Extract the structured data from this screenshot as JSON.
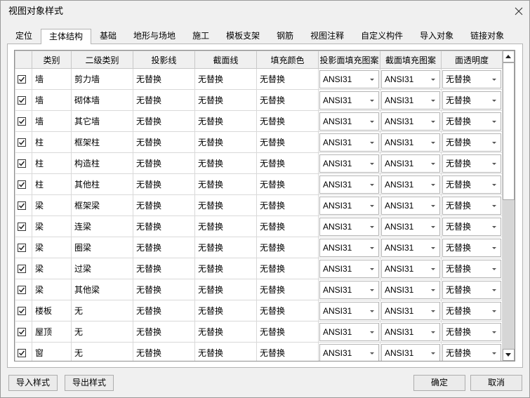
{
  "window": {
    "title": "视图对象样式"
  },
  "tabs": [
    {
      "label": "定位"
    },
    {
      "label": "主体结构",
      "active": true
    },
    {
      "label": "基础"
    },
    {
      "label": "地形与场地"
    },
    {
      "label": "施工"
    },
    {
      "label": "模板支架"
    },
    {
      "label": "钢筋"
    },
    {
      "label": "视图注释"
    },
    {
      "label": "自定义构件"
    },
    {
      "label": "导入对象"
    },
    {
      "label": "链接对象"
    }
  ],
  "table": {
    "headers": {
      "category": "类别",
      "subcategory": "二级类别",
      "projection_line": "投影线",
      "section_line": "截面线",
      "fill_color": "填充颜色",
      "projection_pattern": "投影面填充图案",
      "section_pattern": "截面填充图案",
      "transparency": "面透明度"
    },
    "rows": [
      {
        "checked": true,
        "category": "墙",
        "subcategory": "剪力墙",
        "projection_line": "无替换",
        "section_line": "无替换",
        "fill_color": "无替换",
        "projection_pattern": "ANSI31",
        "section_pattern": "ANSI31",
        "transparency": "无替换"
      },
      {
        "checked": true,
        "category": "墙",
        "subcategory": "砌体墙",
        "projection_line": "无替换",
        "section_line": "无替换",
        "fill_color": "无替换",
        "projection_pattern": "ANSI31",
        "section_pattern": "ANSI31",
        "transparency": "无替换"
      },
      {
        "checked": true,
        "category": "墙",
        "subcategory": "其它墙",
        "projection_line": "无替换",
        "section_line": "无替换",
        "fill_color": "无替换",
        "projection_pattern": "ANSI31",
        "section_pattern": "ANSI31",
        "transparency": "无替换"
      },
      {
        "checked": true,
        "category": "柱",
        "subcategory": "框架柱",
        "projection_line": "无替换",
        "section_line": "无替换",
        "fill_color": "无替换",
        "projection_pattern": "ANSI31",
        "section_pattern": "ANSI31",
        "transparency": "无替换"
      },
      {
        "checked": true,
        "category": "柱",
        "subcategory": "构造柱",
        "projection_line": "无替换",
        "section_line": "无替换",
        "fill_color": "无替换",
        "projection_pattern": "ANSI31",
        "section_pattern": "ANSI31",
        "transparency": "无替换"
      },
      {
        "checked": true,
        "category": "柱",
        "subcategory": "其他柱",
        "projection_line": "无替换",
        "section_line": "无替换",
        "fill_color": "无替换",
        "projection_pattern": "ANSI31",
        "section_pattern": "ANSI31",
        "transparency": "无替换"
      },
      {
        "checked": true,
        "category": "梁",
        "subcategory": "框架梁",
        "projection_line": "无替换",
        "section_line": "无替换",
        "fill_color": "无替换",
        "projection_pattern": "ANSI31",
        "section_pattern": "ANSI31",
        "transparency": "无替换"
      },
      {
        "checked": true,
        "category": "梁",
        "subcategory": "连梁",
        "projection_line": "无替换",
        "section_line": "无替换",
        "fill_color": "无替换",
        "projection_pattern": "ANSI31",
        "section_pattern": "ANSI31",
        "transparency": "无替换"
      },
      {
        "checked": true,
        "category": "梁",
        "subcategory": "圈梁",
        "projection_line": "无替换",
        "section_line": "无替换",
        "fill_color": "无替换",
        "projection_pattern": "ANSI31",
        "section_pattern": "ANSI31",
        "transparency": "无替换"
      },
      {
        "checked": true,
        "category": "梁",
        "subcategory": "过梁",
        "projection_line": "无替换",
        "section_line": "无替换",
        "fill_color": "无替换",
        "projection_pattern": "ANSI31",
        "section_pattern": "ANSI31",
        "transparency": "无替换"
      },
      {
        "checked": true,
        "category": "梁",
        "subcategory": "其他梁",
        "projection_line": "无替换",
        "section_line": "无替换",
        "fill_color": "无替换",
        "projection_pattern": "ANSI31",
        "section_pattern": "ANSI31",
        "transparency": "无替换"
      },
      {
        "checked": true,
        "category": "楼板",
        "subcategory": "无",
        "projection_line": "无替换",
        "section_line": "无替换",
        "fill_color": "无替换",
        "projection_pattern": "ANSI31",
        "section_pattern": "ANSI31",
        "transparency": "无替换"
      },
      {
        "checked": true,
        "category": "屋顶",
        "subcategory": "无",
        "projection_line": "无替换",
        "section_line": "无替换",
        "fill_color": "无替换",
        "projection_pattern": "ANSI31",
        "section_pattern": "ANSI31",
        "transparency": "无替换"
      },
      {
        "checked": true,
        "category": "窗",
        "subcategory": "无",
        "projection_line": "无替换",
        "section_line": "无替换",
        "fill_color": "无替换",
        "projection_pattern": "ANSI31",
        "section_pattern": "ANSI31",
        "transparency": "无替换"
      }
    ],
    "scrollbar": {
      "position_percent": 0,
      "visible_percent": 48
    }
  },
  "buttons": {
    "import_style": "导入样式",
    "export_style": "导出样式",
    "ok": "确定",
    "cancel": "取消"
  },
  "icons": {
    "close": "close-icon",
    "checkbox": "checkmark-icon",
    "dropdown": "chevron-down-icon",
    "scroll_up": "arrow-up-icon",
    "scroll_down": "arrow-down-icon"
  }
}
